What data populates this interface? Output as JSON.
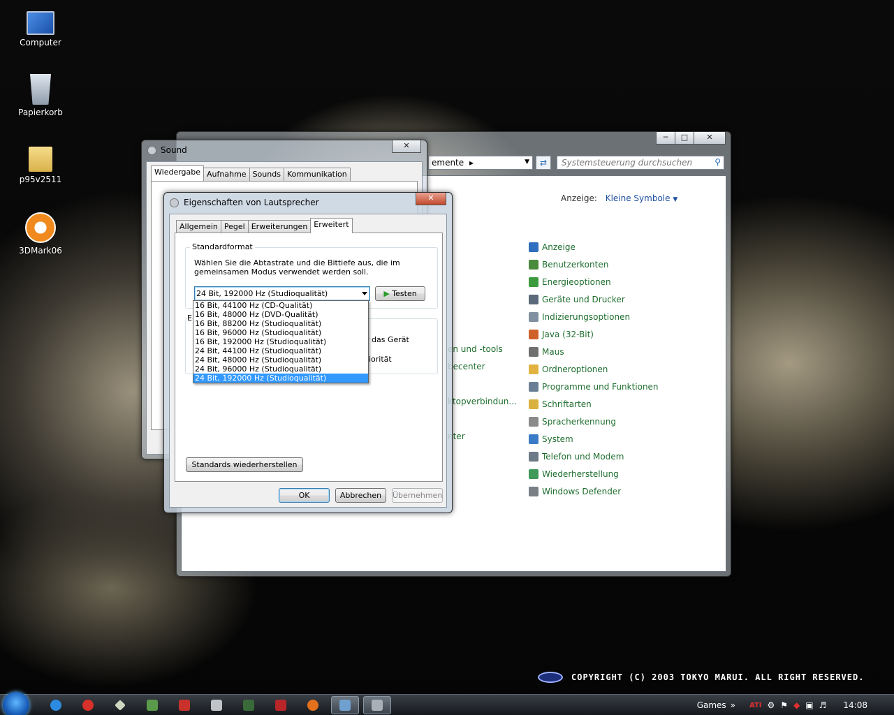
{
  "desktop": {
    "icons": [
      {
        "label": "Computer",
        "icon": "computer-icon"
      },
      {
        "label": "Papierkorb",
        "icon": "recycle-bin-icon"
      },
      {
        "label": "p95v2511",
        "icon": "folder-icon"
      },
      {
        "label": "3DMark06",
        "icon": "3dmark-icon"
      }
    ],
    "copyright": "COPYRIGHT (C) 2003  TOKYO MARUI.  ALL RIGHT RESERVED."
  },
  "control_panel": {
    "address_text": "emente",
    "search_placeholder": "Systemsteuerung durchsuchen",
    "view_label": "Anzeige:",
    "view_value": "Kleine Symbole",
    "partial_items": [
      "en und -tools",
      "becenter",
      "ktopverbindun...",
      "nter"
    ],
    "items": [
      {
        "label": "Anzeige",
        "color": "#2e6fc0"
      },
      {
        "label": "Benutzerkonten",
        "color": "#4a8a3c"
      },
      {
        "label": "Energieoptionen",
        "color": "#3d9b3d"
      },
      {
        "label": "Geräte und Drucker",
        "color": "#5a6a7a"
      },
      {
        "label": "Indizierungsoptionen",
        "color": "#8090a0"
      },
      {
        "label": "Java (32-Bit)",
        "color": "#d0602a"
      },
      {
        "label": "Maus",
        "color": "#707070"
      },
      {
        "label": "Ordneroptionen",
        "color": "#e2b240"
      },
      {
        "label": "Programme und Funktionen",
        "color": "#6a7f95"
      },
      {
        "label": "Schriftarten",
        "color": "#d9b13e"
      },
      {
        "label": "Spracherkennung",
        "color": "#8a8a8a"
      },
      {
        "label": "System",
        "color": "#3a7bc8"
      },
      {
        "label": "Telefon und Modem",
        "color": "#6c7a88"
      },
      {
        "label": "Wiederherstellung",
        "color": "#3f9a5a"
      },
      {
        "label": "Windows Defender",
        "color": "#7a7f86"
      }
    ]
  },
  "sound": {
    "title": "Sound",
    "tabs": [
      "Wiedergabe",
      "Aufnahme",
      "Sounds",
      "Kommunikation"
    ]
  },
  "properties": {
    "title": "Eigenschaften von Lautsprecher",
    "tabs": [
      "Allgemein",
      "Pegel",
      "Erweiterungen",
      "Erweitert"
    ],
    "group_label": "Standardformat",
    "description": "Wählen Sie die Abtastrate und die Bittiefe aus, die im gemeinsamen Modus verwendet werden soll.",
    "selected_format": "24 Bit, 192000 Hz (Studioqualität)",
    "test_button": "Testen",
    "group2_letter": "E",
    "partial_text_1": "r das Gerät",
    "partial_text_2": "iorität",
    "options": [
      "16 Bit, 44100 Hz (CD-Qualität)",
      "16 Bit, 48000 Hz (DVD-Qualität)",
      "16 Bit, 88200 Hz (Studioqualität)",
      "16 Bit, 96000 Hz (Studioqualität)",
      "16 Bit, 192000 Hz (Studioqualität)",
      "24 Bit, 44100 Hz (Studioqualität)",
      "24 Bit, 48000 Hz (Studioqualität)",
      "24 Bit, 96000 Hz (Studioqualität)",
      "24 Bit, 192000 Hz (Studioqualität)"
    ],
    "restore_button": "Standards wiederherstellen",
    "ok_button": "OK",
    "cancel_button": "Abbrechen",
    "apply_button": "Übernehmen"
  },
  "taskbar": {
    "toolbar_label": "Games",
    "clock": "14:08",
    "tray_ati": "ATI"
  }
}
